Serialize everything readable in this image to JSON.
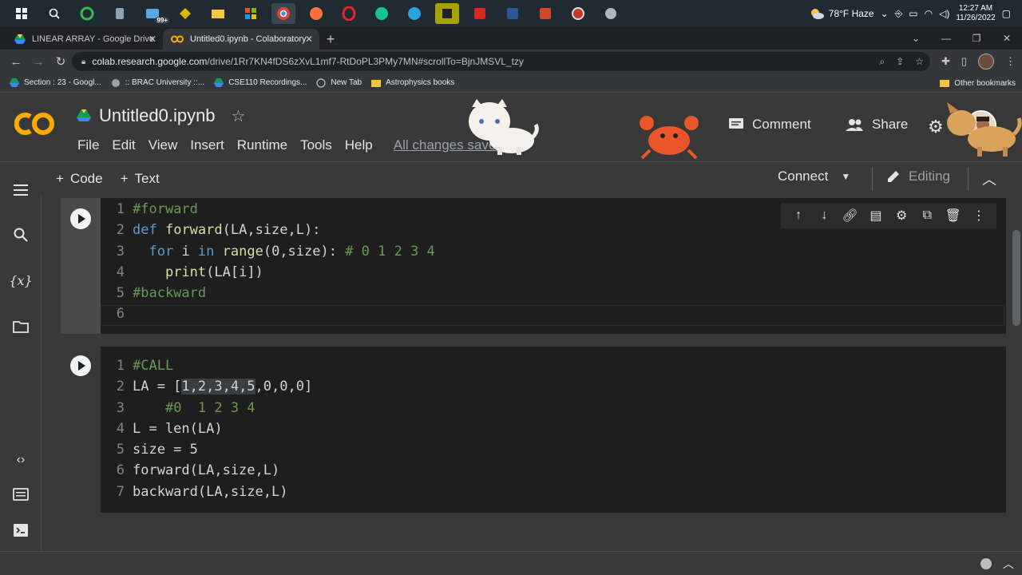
{
  "taskbar": {
    "notification_count": "99+",
    "weather": "78°F Haze",
    "time": "12:27 AM",
    "date": "11/26/2022"
  },
  "tabs": [
    {
      "title": "LINEAR ARRAY - Google Drive",
      "active": false
    },
    {
      "title": "Untitled0.ipynb - Colaboratory",
      "active": true
    }
  ],
  "address": {
    "host": "colab.research.google.com",
    "path": "/drive/1Rr7KN4fDS6zXvL1mf7-RtDoPL3PMy7MN#scrollTo=BjnJMSVL_tzy"
  },
  "bookmarks": [
    {
      "label": "Section : 23 - Googl..."
    },
    {
      "label": ":: BRAC University ::..."
    },
    {
      "label": "CSE110 Recordings..."
    },
    {
      "label": "New Tab"
    },
    {
      "label": "Astrophysics books"
    }
  ],
  "other_bookmarks": "Other bookmarks",
  "notebook": {
    "title": "Untitled0.ipynb",
    "menu": [
      "File",
      "Edit",
      "View",
      "Insert",
      "Runtime",
      "Tools",
      "Help"
    ],
    "save_status": "All changes saved",
    "comment_label": "Comment",
    "share_label": "Share",
    "add_code_label": "Code",
    "add_text_label": "Text",
    "connect_label": "Connect",
    "editing_label": "Editing"
  },
  "cells": {
    "cell1": {
      "lines": [
        "1",
        "2",
        "3",
        "4",
        "5",
        "6"
      ],
      "l1": "#forward",
      "l2_kw": "def",
      "l2_fn": "forward",
      "l2_args": "(LA,size,L):",
      "l3_kw1": "for",
      "l3_var": " i ",
      "l3_kw2": "in",
      "l3_fn": " range",
      "l3_args": "(0,size): ",
      "l3_com": "# 0 1 2 3 4",
      "l4_fn": "print",
      "l4_args": "(LA[i])",
      "l5": "#backward"
    },
    "cell2": {
      "lines": [
        "1",
        "2",
        "3",
        "4",
        "5",
        "6",
        "7"
      ],
      "l1": "#CALL",
      "l2_pre": "LA = [",
      "l2_hl": "1,2,3,4,5",
      "l2_post": ",0,0,0]",
      "l3": "#0  1 2 3 4",
      "l4": "L = len(LA)",
      "l5": "size = 5",
      "l6": "forward(LA,size,L)",
      "l7": "backward(LA,size,L)"
    }
  },
  "colors": {
    "comment": "#6a9955",
    "keyword": "#569cd6",
    "function": "#dcdcaa",
    "background": "#1e1e1e",
    "panel": "#383838"
  }
}
